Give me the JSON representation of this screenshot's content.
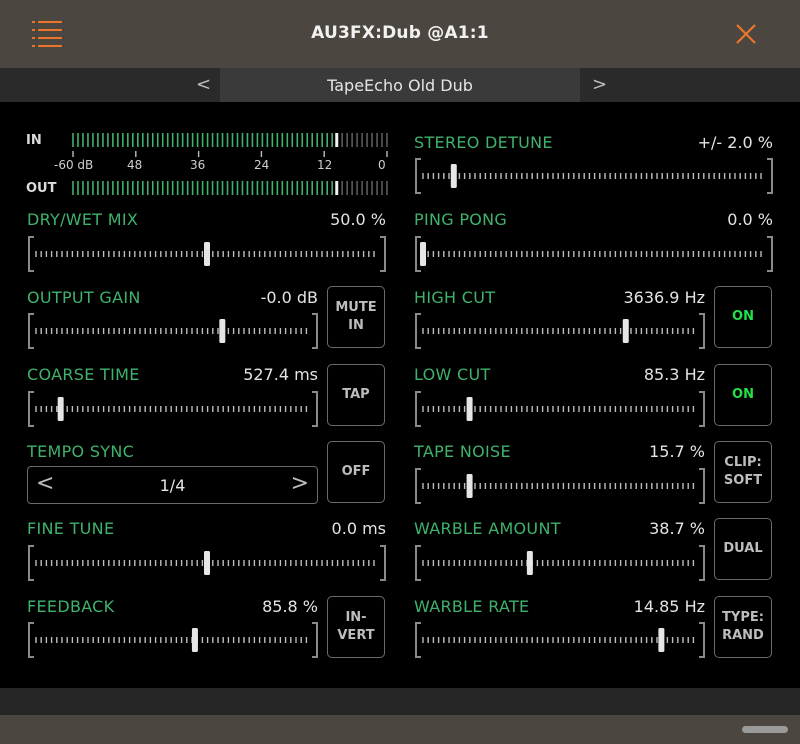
{
  "window": {
    "title": "AU3FX:Dub @A1:1"
  },
  "preset": {
    "name": "TapeEcho Old Dub",
    "prev": "<",
    "next": ">"
  },
  "meter": {
    "in_label": "IN",
    "out_label": "OUT",
    "scale": [
      "-60 dB",
      "48",
      "36",
      "24",
      "12",
      "0"
    ],
    "in_level": 0.84,
    "out_level": 0.84
  },
  "params": {
    "dry_wet": {
      "label": "DRY/WET MIX",
      "value": "50.0 %",
      "position": 0.5
    },
    "output_gain": {
      "label": "OUTPUT GAIN",
      "value": "-0.0 dB",
      "position": 0.68
    },
    "coarse_time": {
      "label": "COARSE TIME",
      "value": "527.4 ms",
      "position": 0.09
    },
    "tempo_sync": {
      "label": "TEMPO SYNC",
      "value": "1/4",
      "prev": "<",
      "next": ">"
    },
    "fine_tune": {
      "label": "FINE TUNE",
      "value": "0.0 ms",
      "position": 0.5
    },
    "feedback": {
      "label": "FEEDBACK",
      "value": "85.8 %",
      "position": 0.58
    },
    "stereo_detune": {
      "label": "STEREO DETUNE",
      "value": "+/- 2.0 %",
      "position": 0.09
    },
    "ping_pong": {
      "label": "PING PONG",
      "value": "0.0 %",
      "position": 0.0
    },
    "high_cut": {
      "label": "HIGH CUT",
      "value": "3636.9 Hz",
      "position": 0.74
    },
    "low_cut": {
      "label": "LOW CUT",
      "value": "85.3 Hz",
      "position": 0.17
    },
    "tape_noise": {
      "label": "TAPE NOISE",
      "value": "15.7 %",
      "position": 0.17
    },
    "warble_amount": {
      "label": "WARBLE AMOUNT",
      "value": "38.7 %",
      "position": 0.39
    },
    "warble_rate": {
      "label": "WARBLE RATE",
      "value": "14.85 Hz",
      "position": 0.87
    }
  },
  "buttons": {
    "mute_in": "MUTE\nIN",
    "tap": "TAP",
    "sync": "OFF",
    "invert": "IN-\nVERT",
    "high_cut_toggle": "ON",
    "low_cut_toggle": "ON",
    "clip": "CLIP:\nSOFT",
    "dual": "DUAL",
    "type": "TYPE:\nRAND"
  },
  "colors": {
    "label_green": "#3fb26c",
    "on_green": "#23e04a",
    "header_bg": "#4b463f",
    "accent_orange": "#e8762b"
  }
}
